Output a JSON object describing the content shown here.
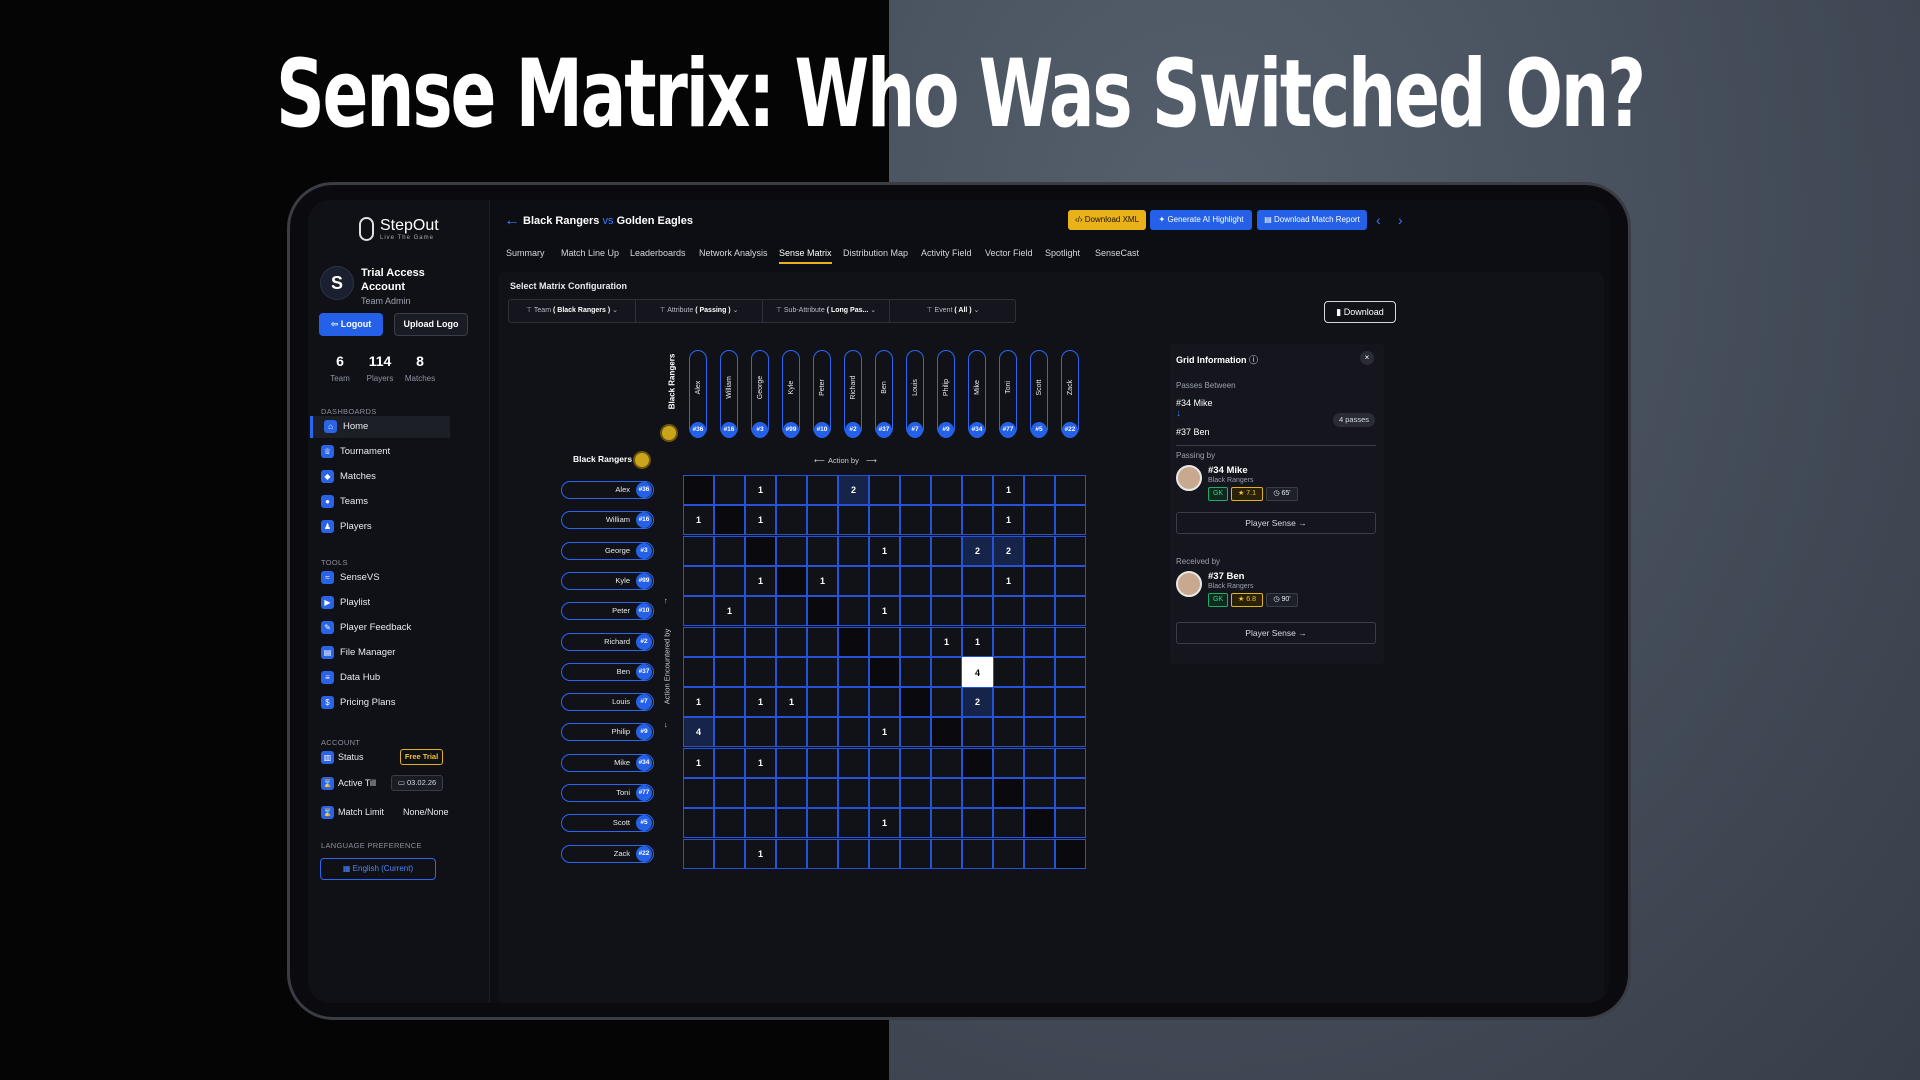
{
  "headline": "Sense Matrix: Who Was Switched On?",
  "brand": {
    "name": "StepOut",
    "tagline": "Live The Game"
  },
  "account": {
    "name": "Trial Access Account",
    "role": "Team Admin",
    "logout": "Logout",
    "upload": "Upload Logo"
  },
  "stats": [
    {
      "value": "6",
      "label": "Team"
    },
    {
      "value": "114",
      "label": "Players"
    },
    {
      "value": "8",
      "label": "Matches"
    }
  ],
  "sections": {
    "dashboards": "DASHBOARDS",
    "tools": "TOOLS",
    "account": "ACCOUNT",
    "language": "LANGUAGE PREFERENCE"
  },
  "nav_dashboards": [
    "Home",
    "Tournament",
    "Matches",
    "Teams",
    "Players"
  ],
  "nav_tools": [
    "SenseVS",
    "Playlist",
    "Player Feedback",
    "File Manager",
    "Data Hub",
    "Pricing Plans"
  ],
  "account_rows": {
    "status": "Status",
    "status_badge": "Free Trial",
    "active_till": "Active Till",
    "active_date": "03.02.26",
    "match_limit": "Match Limit",
    "match_limit_val": "None/None"
  },
  "language": "English (Current)",
  "match": {
    "home": "Black Rangers",
    "vs": "vs",
    "away": "Golden Eagles"
  },
  "actions": {
    "xml": "Download XML",
    "ai": "Generate AI Highlight",
    "report": "Download Match Report"
  },
  "tabs": [
    "Summary",
    "Match Line Up",
    "Leaderboards",
    "Network Analysis",
    "Sense Matrix",
    "Distribution Map",
    "Activity Field",
    "Vector Field",
    "Spotlight",
    "SenseCast"
  ],
  "config": {
    "title": "Select Matrix Configuration",
    "filters": [
      {
        "label": "Team",
        "value": "( Black Rangers )"
      },
      {
        "label": "Attribute",
        "value": "( Passing )"
      },
      {
        "label": "Sub-Attribute",
        "value": "( Long Pas..."
      },
      {
        "label": "Event",
        "value": "( All )"
      }
    ],
    "download": "Download"
  },
  "matrix": {
    "team": "Black Rangers",
    "action_by": "Action by",
    "action_encountered": "Action Encountered by",
    "players": [
      {
        "name": "Alex",
        "num": "#36"
      },
      {
        "name": "William",
        "num": "#16"
      },
      {
        "name": "George",
        "num": "#3"
      },
      {
        "name": "Kyle",
        "num": "#99"
      },
      {
        "name": "Peter",
        "num": "#10"
      },
      {
        "name": "Richard",
        "num": "#2"
      },
      {
        "name": "Ben",
        "num": "#37"
      },
      {
        "name": "Louis",
        "num": "#7"
      },
      {
        "name": "Philip",
        "num": "#9"
      },
      {
        "name": "Mike",
        "num": "#34"
      },
      {
        "name": "Toni",
        "num": "#77"
      },
      {
        "name": "Scott",
        "num": "#5"
      },
      {
        "name": "Zack",
        "num": "#22"
      }
    ],
    "values": [
      [
        "",
        "",
        "1",
        "",
        "",
        "2",
        "",
        "",
        "",
        "",
        "1",
        "",
        ""
      ],
      [
        "1",
        "",
        "1",
        "",
        "",
        "",
        "",
        "",
        "",
        "",
        "1",
        "",
        ""
      ],
      [
        "",
        "",
        "",
        "",
        "",
        "",
        "1",
        "",
        "",
        "2",
        "2",
        "",
        ""
      ],
      [
        "",
        "",
        "1",
        "",
        "1",
        "",
        "",
        "",
        "",
        "",
        "1",
        "",
        ""
      ],
      [
        "",
        "1",
        "",
        "",
        "",
        "",
        "1",
        "",
        "",
        "",
        "",
        "",
        ""
      ],
      [
        "",
        "",
        "",
        "",
        "",
        "",
        "",
        "",
        "1",
        "1",
        "",
        "",
        ""
      ],
      [
        "",
        "",
        "",
        "",
        "",
        "",
        "",
        "",
        "",
        "4",
        "",
        "",
        ""
      ],
      [
        "1",
        "",
        "1",
        "1",
        "",
        "",
        "",
        "",
        "",
        "2",
        "",
        "",
        ""
      ],
      [
        "4",
        "",
        "",
        "",
        "",
        "",
        "1",
        "",
        "",
        "",
        "",
        "",
        ""
      ],
      [
        "1",
        "",
        "1",
        "",
        "",
        "",
        "",
        "",
        "",
        "",
        "",
        "",
        ""
      ],
      [
        "",
        "",
        "",
        "",
        "",
        "",
        "",
        "",
        "",
        "",
        "",
        "",
        ""
      ],
      [
        "",
        "",
        "",
        "",
        "",
        "",
        "1",
        "",
        "",
        "",
        "",
        "",
        ""
      ],
      [
        "",
        "",
        "1",
        "",
        "",
        "",
        "",
        "",
        "",
        "",
        "",
        "",
        ""
      ]
    ],
    "highlight": {
      "row": 6,
      "col": 9
    }
  },
  "grid_info": {
    "title": "Grid Information",
    "passes_between": "Passes Between",
    "from": "#34 Mike",
    "to": "#37 Ben",
    "passes": "4 passes",
    "passing_by": "Passing by",
    "passer": {
      "name": "#34 Mike",
      "team": "Black Rangers",
      "pos": "GK",
      "rating": "★ 7.1",
      "minutes": "65'"
    },
    "received_by": "Received by",
    "receiver": {
      "name": "#37 Ben",
      "team": "Black Rangers",
      "pos": "GK",
      "rating": "★ 6.8",
      "minutes": "90'"
    },
    "player_sense": "Player Sense →"
  }
}
